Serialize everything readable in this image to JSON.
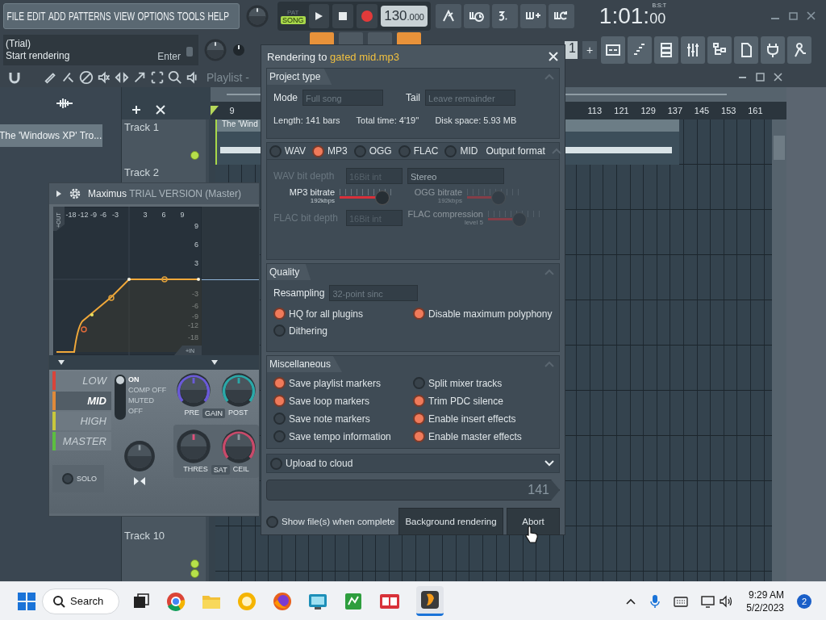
{
  "menu": [
    "FILE",
    "EDIT",
    "ADD",
    "PATTERNS",
    "VIEW",
    "OPTIONS",
    "TOOLS",
    "HELP"
  ],
  "transport": {
    "modes": [
      {
        "label": "PAT",
        "selected": false
      },
      {
        "label": "SONG",
        "selected": true
      }
    ],
    "tempo": "130",
    "tempo_fraction": ".000"
  },
  "clock": {
    "time": "1:01:",
    "sub": "00",
    "unit": "B:S:T"
  },
  "hint": {
    "title": "(Trial)",
    "text": "Start rendering",
    "shortcut": "Enter"
  },
  "pattern": {
    "value": "1",
    "add": "+"
  },
  "browser": {
    "item": "The 'Windows XP' Tro..."
  },
  "playlist": {
    "title": "Playlist -",
    "ruler_start": [
      "9"
    ],
    "ruler_end": [
      "113",
      "121",
      "129",
      "137",
      "145",
      "153",
      "161"
    ],
    "clip": "The 'Wind",
    "tracks_top": [
      "Track 1",
      "Track 2"
    ],
    "tracks_bottom": [
      "Track 10"
    ]
  },
  "maximus": {
    "name": "Maximus",
    "subtitle": "TRIAL VERSION (Master)",
    "out_label": "+OUT",
    "in_label": "+IN",
    "out_ticks": [
      "-18",
      "-12",
      "-9",
      "-6",
      "-3",
      "3",
      "6",
      "9"
    ],
    "in_ticks": [
      "9",
      "6",
      "3",
      "-3",
      "-6",
      "-9",
      "-12",
      "-18"
    ],
    "bands": [
      {
        "label": "LOW",
        "color": "#d9443a",
        "selected": false
      },
      {
        "label": "MID",
        "color": "#e08a3a",
        "selected": true
      },
      {
        "label": "HIGH",
        "color": "#c8c83c",
        "selected": false
      },
      {
        "label": "MASTER",
        "color": "#5cbf40",
        "selected": false
      }
    ],
    "states": [
      {
        "label": "ON",
        "selected": true
      },
      {
        "label": "COMP OFF",
        "selected": false
      },
      {
        "label": "MUTED",
        "selected": false
      },
      {
        "label": "OFF",
        "selected": false
      }
    ],
    "gain": [
      "PRE",
      "GAIN",
      "POST"
    ],
    "limit": [
      "THRES",
      "SAT",
      "CEIL"
    ],
    "solo": "SOLO"
  },
  "render": {
    "title": "Rendering to",
    "file": "gated mid.mp3",
    "project": {
      "title": "Project type",
      "mode_label": "Mode",
      "mode": "Full song",
      "tail_label": "Tail",
      "tail": "Leave remainder",
      "stats": [
        "Length: 141 bars",
        "Total time: 4'19''",
        "Disk space: 5.93 MB"
      ]
    },
    "output": {
      "title": "Output format",
      "formats": [
        {
          "label": "WAV",
          "selected": false
        },
        {
          "label": "MP3",
          "selected": true
        },
        {
          "label": "OGG",
          "selected": false
        },
        {
          "label": "FLAC",
          "selected": false
        },
        {
          "label": "MID",
          "selected": false
        }
      ],
      "wav_depth": {
        "label": "WAV bit depth",
        "value": "16Bit int",
        "disabled": true
      },
      "channels": "Stereo",
      "sliders": [
        {
          "label": "MP3 bitrate",
          "reading": "192kbps",
          "level": 0.75,
          "disabled": false
        },
        {
          "label": "OGG bitrate",
          "reading": "192kbps",
          "level": 0.55,
          "disabled": true
        }
      ],
      "flac_depth": {
        "label": "FLAC bit depth",
        "value": "16Bit int",
        "disabled": true
      },
      "flac_slider": {
        "label": "FLAC compression",
        "reading": "level 5",
        "level": 0.55,
        "disabled": true
      }
    },
    "quality": {
      "title": "Quality",
      "resampling_label": "Resampling",
      "resampling": "32-point sinc",
      "options": [
        {
          "label": "HQ for all plugins",
          "checked": true
        },
        {
          "label": "Disable maximum polyphony",
          "checked": true
        },
        {
          "label": "Dithering",
          "checked": false
        }
      ]
    },
    "misc": {
      "title": "Miscellaneous",
      "options": [
        {
          "label": "Save playlist markers",
          "checked": true
        },
        {
          "label": "Split mixer tracks",
          "checked": false
        },
        {
          "label": "Save loop markers",
          "checked": true
        },
        {
          "label": "Trim PDC silence",
          "checked": true
        },
        {
          "label": "Save note markers",
          "checked": false
        },
        {
          "label": "Enable insert effects",
          "checked": true
        },
        {
          "label": "Save tempo information",
          "checked": false
        },
        {
          "label": "Enable master effects",
          "checked": true
        }
      ]
    },
    "upload": {
      "label": "Upload to cloud",
      "checked": false
    },
    "progress": "141",
    "show_files": {
      "label": "Show file(s) when complete",
      "checked": false
    },
    "buttons": [
      "Background rendering",
      "Abort"
    ]
  },
  "taskbar": {
    "search": "Search",
    "time": "9:29 AM",
    "date": "5/2/2023",
    "badge": "2"
  }
}
